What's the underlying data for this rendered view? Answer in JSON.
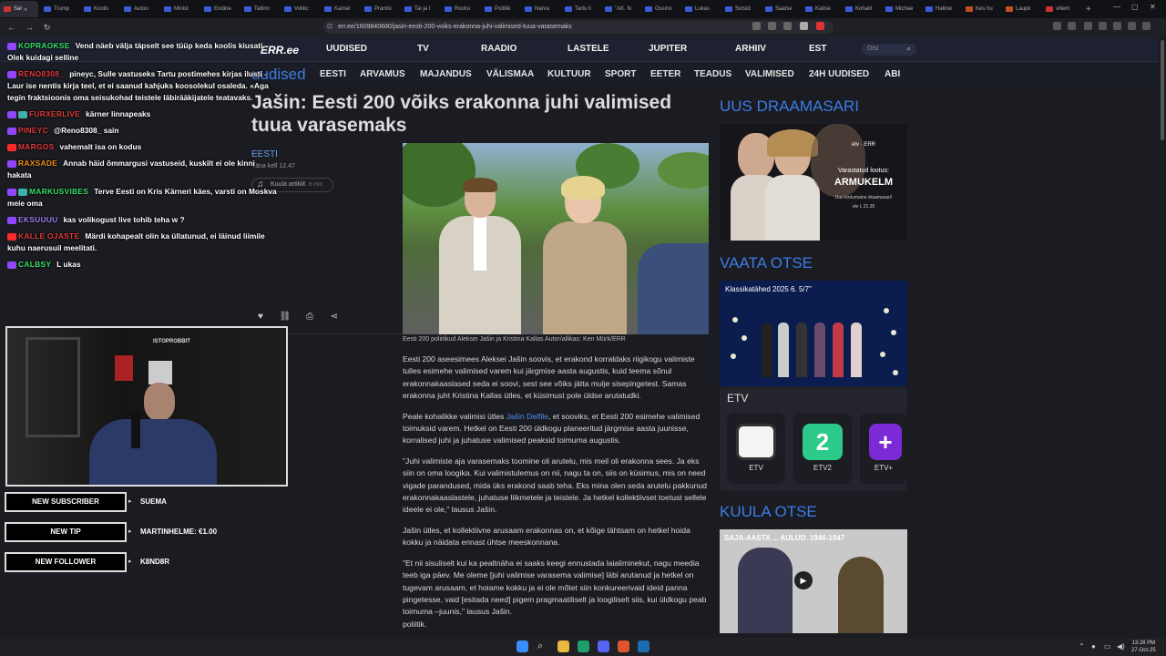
{
  "browser": {
    "tabs": [
      "Sal",
      "Trump",
      "Koolis",
      "Autoo",
      "Minist",
      "Endine",
      "Tallinn",
      "Volikc",
      "Kamal",
      "Prantsi",
      "Tai ja l",
      "Rootsi",
      "Politiik",
      "Narva",
      "Tartu li",
      "\"AK. N",
      "Ossino",
      "Lukas",
      "Sotsid",
      "Saatse",
      "Kaitse",
      "Kohalil",
      "Michae",
      "Hallow",
      "Kes hu",
      "Laupk",
      "villem"
    ],
    "url": "err.ee/1609840680/jasin-eesti-200-voiks-erakonna-juhi-valimised-tuua-varasemaks",
    "new_tab": "+",
    "close_tab": "×"
  },
  "site": {
    "logo": "ERR.ee",
    "topnav": [
      "UUDISED",
      "TV",
      "RAADIO",
      "LASTELE",
      "JUPITER",
      "ARHIIV",
      "EST"
    ],
    "search_placeholder": "Otsi",
    "section_title": "uudised",
    "subnav": [
      "EESTI",
      "ARVAMUS",
      "MAJANDUS",
      "VÄLISMAA",
      "KULTUUR",
      "SPORT",
      "EETER",
      "TEADUS",
      "VALIMISED",
      "24H UUDISED",
      "ABI"
    ]
  },
  "article": {
    "headline": "Jašin: Eesti 200 võiks erakonna juhi valimised tuua varasemaks",
    "section": "EESTI",
    "timestamp": "Täna kell 12.47",
    "listen_label": "Kuula artiklit",
    "listen_duration": "6 min",
    "caption": "Eesti 200 poliitikud Aleksei Jašin ja Kristina Kallas Autor/allikas: Ken Mürk/ERR",
    "paragraphs": [
      "Eesti 200 aseesimees Aleksei Jašin soovis, et erakond korraldaks riigikogu valimiste tulles esimehe valimised varem kui järgmise aasta augustis, kuid teema sõnul erakonnakaaslased seda ei soovi, sest see võiks jätta mulje sisepingetest. Samas erakonna juht Kristina Kallas ütles, et küsimust pole üldse arutatudki.",
      "Peale kohalikke valimisi ütles ",
      ", et sooviks, et Eesti 200 esimehe valimised toimuksid varem. Hetkel on Eesti 200 üldkogu planeeritud järgmise aasta juunisse, korralised juhi ja juhatuse valimised peaksid toimuma augustis.",
      "\"Juhi valimiste aja varasemaks toomine oli arutelu, mis meil oli erakonna sees. Ja eks siin on oma loogika. Kui valimistulemus on nii, nagu ta on, siis on küsimus, mis on need vigade parandused, mida üks erakond saab teha. Eks mina olen seda arutelu pakkunud erakonnakaaslastele, juhatuse liikmetele ja teistele. Ja hetkel kollektiivset toetust sellele ideele ei ole,\" lausus Jašin.",
      "Jašin ütles, et kollektiivne arusaam erakonnas on, et kõige tähtsam on hetkel hoida kokku ja näidata ennast ühtse meeskonnana.",
      "\"Et nii sisuliselt kui ka pealtnäha ei saaks keegi ennustada laialiminekut, nagu meedia teeb iga päev. Me oleme [juhi valimise varasema valimise] läbi arutanud ja hetkel on tugevam arusaam, et hoiame kokku ja ei ole mõtet siin konkureerivaid ideid panna pingetesse, vaid [esitada need] pigem pragmaatiliselt ja loogiliselt siis, kui üldkogu peab toimuma –juunis,\" lausus Jašin.",
      "poliitik."
    ],
    "link_text": "Jašin Delfile"
  },
  "sidebar": {
    "drama_heading": "UUS DRAAMASARI",
    "drama_logo": "etv · ERR",
    "drama_tagline": "Varastatud lootus:",
    "drama_title": "ARMUKELM",
    "drama_sub": "Uus kodumaine draamasari!",
    "drama_time": "etv L 21.35",
    "live_heading": "VAATA OTSE",
    "live_title": "Klassikatähed 2025 6. 5/7\"",
    "etv_heading": "ETV",
    "channels": [
      "ETV",
      "ETV2",
      "ETV+"
    ],
    "radio_heading": "KUULA OTSE",
    "radio_title": "SAJA-AASTA ... AULUD. 1946-1947"
  },
  "chat": [
    {
      "user": "KOPRAOKSE",
      "text": "Vend näeb välja täpselt see tüüp keda koolis kiusati. Olek kuidagi selline",
      "color": "#38e068",
      "icon": "twitch"
    },
    {
      "user": "RENO8308_",
      "text": "pineyc, Sulle vastuseks Tartu postimehes kirjas ilusti - Laur ise nentis kirja teel, et ei saanud kahjuks koosolekul osaleda. «Aga tegin fraktsioonis oma seisukohad teistele läbirääkijatele teatavaks.",
      "color": "#e23a3a",
      "icon": "twitch"
    },
    {
      "user": "FURXERLIVE",
      "text": "kärner linnapeaks",
      "color": "#e23a3a",
      "icon": "twitch2"
    },
    {
      "user": "PINEYC",
      "text": "@Reno8308_ sain",
      "color": "#e23a3a",
      "icon": "twitch"
    },
    {
      "user": "MARGOS",
      "text": "vahemalt isa on kodus",
      "color": "#e23a3a",
      "icon": "youtube"
    },
    {
      "user": "RAXSADE",
      "text": "Annab häid õmmargusi vastuseid, kuskilt ei ole kinni hakata",
      "color": "#f09018",
      "icon": "twitch"
    },
    {
      "user": "MARKUSVIBES",
      "text": "Terve Eesti on Kris Kärneri käes, varsti on Moskva meie oma",
      "color": "#38e068",
      "icon": "twitch2"
    },
    {
      "user": "EKSUUUU",
      "text": "kas volikogust live tohib teha w ?",
      "color": "#a07ef0",
      "icon": "twitch"
    },
    {
      "user": "KALLE OJASTE",
      "text": "Märdi kohapealt olin ka üllatunud, ei läinud liimile kuhu naerusuil meelitati.",
      "color": "#e23a3a",
      "icon": "youtube"
    },
    {
      "user": "CALBSY",
      "text": "L ukas",
      "color": "#38e068",
      "icon": "twitch"
    }
  ],
  "webcam_sign": "ISTOPROBBIT",
  "alerts": [
    {
      "label": "NEW SUBSCRIBER",
      "value": "SUEMA"
    },
    {
      "label": "NEW TIP",
      "value": "MARTINHELME: €1.00"
    },
    {
      "label": "NEW FOLLOWER",
      "value": "K8ND8R"
    }
  ],
  "taskbar": {
    "time": "13:28 PM",
    "date": "27-Oct-25"
  },
  "colors": {
    "accent": "#3d7ce6",
    "page_bg": "#1b1c22"
  }
}
